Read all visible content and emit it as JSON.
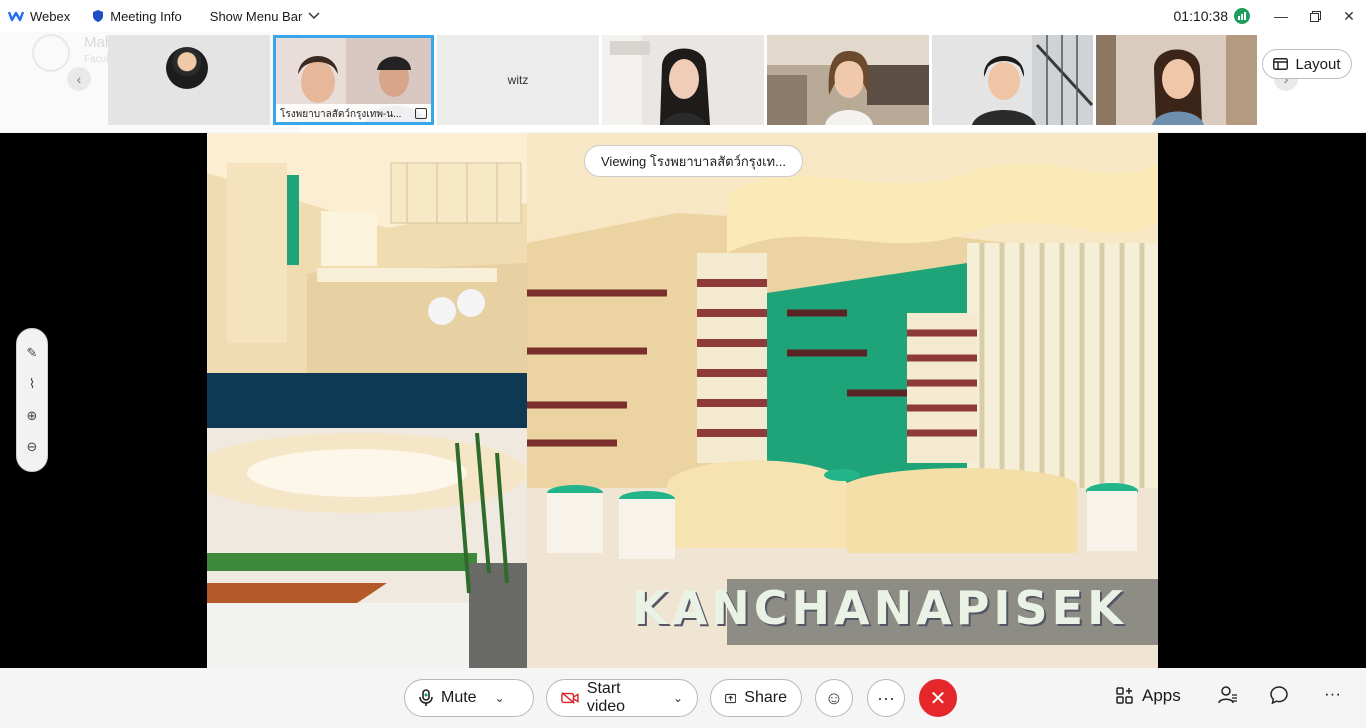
{
  "titlebar": {
    "app_name": "Webex",
    "meeting_info": "Meeting Info",
    "show_menu_bar": "Show Menu Bar",
    "clock": "01:10:38",
    "colors": {
      "app_logo": "#1d6ff2",
      "signal": "#1f9e5b"
    }
  },
  "filmstrip": {
    "tiles": [
      {
        "name": "",
        "type": "avatar"
      },
      {
        "name": "โรงพยาบาลสัตว์กรุงเทพ-น...",
        "type": "video",
        "active": true,
        "sharing": true
      },
      {
        "name": "witz",
        "type": "name-only"
      },
      {
        "name": "",
        "type": "video"
      },
      {
        "name": "",
        "type": "video"
      },
      {
        "name": "",
        "type": "video"
      },
      {
        "name": "",
        "type": "video"
      }
    ],
    "layout_label": "Layout",
    "ghost_brand": "Mahidol University",
    "ghost_brand_sub": "Faculty of Veterinary Science"
  },
  "stage": {
    "viewing_label": "Viewing โรงพยาบาลสัตว์กรุงเท...",
    "slide_caption": "KANCHANAPISEK",
    "colors": {
      "panel_band": "#0d3a52",
      "accent_green": "#1fa47a"
    }
  },
  "annotation_tools": [
    "draw-icon",
    "highlighter-icon",
    "zoom-in-icon",
    "zoom-out-icon"
  ],
  "controls": {
    "mute_label": "Mute",
    "start_video_label": "Start video",
    "share_label": "Share",
    "apps_label": "Apps",
    "colors": {
      "end_call": "#e5262b",
      "video_off": "#d9262d"
    }
  }
}
